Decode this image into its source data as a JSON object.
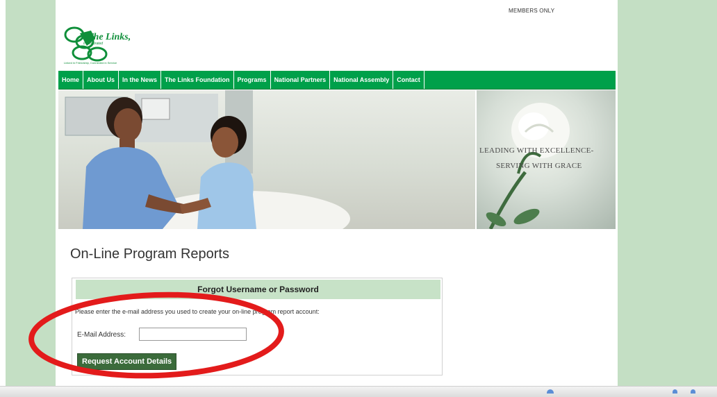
{
  "header": {
    "members_only": "MEMBERS ONLY",
    "logo_text": "The Links,",
    "logo_sub": "Incorporated",
    "logo_tagline": "Linked in Friendship, Connected in Service"
  },
  "nav": {
    "items": [
      {
        "label": "Home"
      },
      {
        "label": "About Us"
      },
      {
        "label": "In the News"
      },
      {
        "label": "The Links Foundation"
      },
      {
        "label": "Programs"
      },
      {
        "label": "National Partners"
      },
      {
        "label": "National Assembly"
      },
      {
        "label": "Contact"
      }
    ]
  },
  "banner": {
    "line1": "LEADING WITH EXCELLENCE-",
    "line2": "SERVING WITH GRACE"
  },
  "main": {
    "title": "On-Line Program Reports",
    "form": {
      "heading": "Forgot Username or Password",
      "instructions": "Please enter the e-mail address you used to create your on-line program report account:",
      "email_label": "E-Mail Address:",
      "email_value": "",
      "submit_label": "Request Account Details"
    }
  },
  "colors": {
    "nav_green": "#00a04a",
    "side_green": "#c4dfc4",
    "form_header": "#c7e2c7",
    "button_green": "#3b6b3b",
    "annotation_red": "#e31b1b"
  }
}
